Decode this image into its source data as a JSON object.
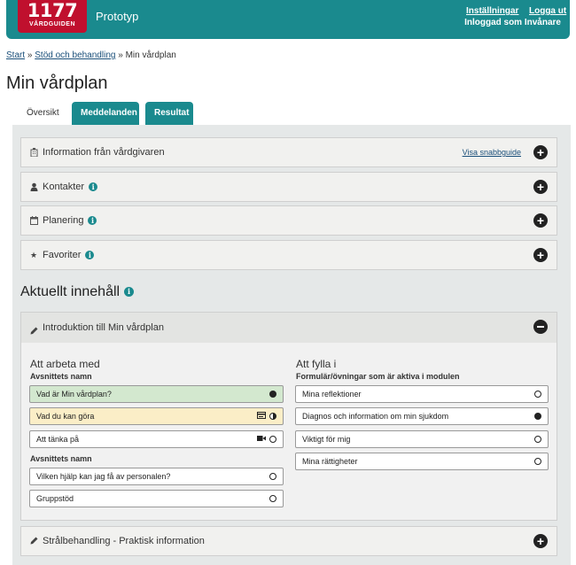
{
  "header": {
    "logo_number": "1177",
    "logo_sub": "VÅRDGUIDEN",
    "app_name": "Prototyp",
    "settings": "Inställningar",
    "logout": "Logga ut",
    "user": "Inloggad som Invånare"
  },
  "breadcrumb": {
    "start": "Start",
    "sep1": "»",
    "section": "Stöd och behandling",
    "sep2": "»",
    "current": "Min vårdplan"
  },
  "page_title": "Min vårdplan",
  "tabs": [
    {
      "label": "Översikt",
      "active": true
    },
    {
      "label": "Meddelanden",
      "active": false
    },
    {
      "label": "Resultat",
      "active": false
    }
  ],
  "accordions": [
    {
      "label": "Information från vårdgivaren",
      "icon": "building-icon",
      "link": "Visa snabbguide"
    },
    {
      "label": "Kontakter",
      "icon": "person-icon"
    },
    {
      "label": "Planering",
      "icon": "calendar-icon"
    },
    {
      "label": "Favoriter",
      "icon": "star-icon"
    }
  ],
  "aktuellt_title": "Aktuellt innehåll",
  "module": {
    "title": "Introduktion till Min vårdplan",
    "left_title": "Att arbeta med",
    "left_sub1": "Avsnittets namn",
    "left_items1": [
      {
        "label": "Vad är Min vårdplan?",
        "status": "done",
        "bg": "#d3e8cf"
      },
      {
        "label": "Vad du kan göra",
        "status": "half",
        "bg": "#fbeec7",
        "icon": "card-icon"
      },
      {
        "label": "Att tänka på",
        "status": "empty",
        "bg": "#ffffff",
        "icon": "video-icon"
      }
    ],
    "left_sub2": "Avsnittets namn",
    "left_items2": [
      {
        "label": "Vilken hjälp kan jag få av personalen?",
        "status": "empty"
      },
      {
        "label": "Gruppstöd",
        "status": "empty"
      }
    ],
    "right_title": "Att fylla i",
    "right_sub": "Formulär/övningar som är aktiva i modulen",
    "right_items": [
      {
        "label": "Mina reflektioner",
        "status": "empty"
      },
      {
        "label": "Diagnos och information om min sjukdom",
        "status": "done"
      },
      {
        "label": "Viktigt för mig",
        "status": "empty"
      },
      {
        "label": "Mina rättigheter",
        "status": "empty"
      }
    ]
  },
  "bottom_accordion": {
    "label": "Strålbehandling - Praktisk information",
    "icon": "pencil-icon"
  },
  "colors": {
    "brand_teal": "#1a8a8e",
    "logo_red": "#c0102e"
  }
}
